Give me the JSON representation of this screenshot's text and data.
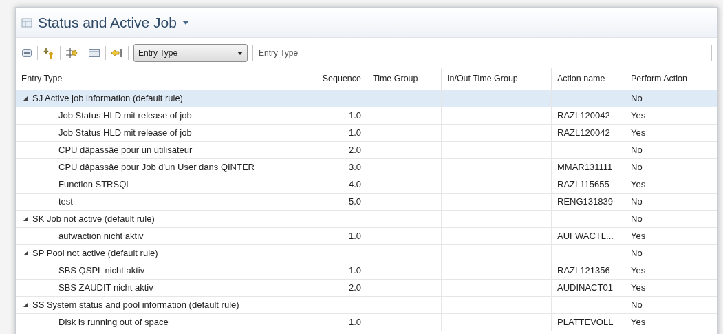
{
  "view": {
    "title": "Status and Active Job"
  },
  "toolbar": {
    "filter_column": "Entry Type",
    "filter_field": {
      "placeholder": "Entry Type"
    }
  },
  "table": {
    "columns": [
      "Entry Type",
      "Sequence",
      "Time Group",
      "In/Out Time Group",
      "Action name",
      "Perform Action"
    ],
    "groups": [
      {
        "label": "SJ Active job information (default rule)",
        "expanded": true,
        "selected": true,
        "perform": "No",
        "children": [
          {
            "entry": "Job Status HLD mit release of job",
            "sequence": "1.0",
            "action": "RAZL120042",
            "perform": "Yes"
          },
          {
            "entry": "Job Status HLD mit release of job",
            "sequence": "1.0",
            "action": "RAZL120042",
            "perform": "Yes"
          },
          {
            "entry": "CPU dâpassâe  pour un utilisateur",
            "sequence": "2.0",
            "perform": "No"
          },
          {
            "entry": "CPU dâpassâe pour Job d'un User dans QINTER",
            "sequence": "3.0",
            "action": "MMAR131111",
            "perform": "No"
          },
          {
            "entry": "Function STRSQL",
            "sequence": "4.0",
            "action": "RAZL115655",
            "perform": "Yes"
          },
          {
            "entry": "test",
            "sequence": "5.0",
            "action": "RENG131839",
            "perform": "No"
          }
        ]
      },
      {
        "label": "SK Job not active (default rule)",
        "expanded": true,
        "selected": false,
        "perform": "No",
        "children": [
          {
            "entry": "aufwaction nicht aktiv",
            "sequence": "1.0",
            "action": "AUFWACTL...",
            "perform": "Yes"
          }
        ]
      },
      {
        "label": "SP Pool not active (default rule)",
        "expanded": true,
        "selected": false,
        "perform": "No",
        "children": [
          {
            "entry": "SBS QSPL nicht aktiv",
            "sequence": "1.0",
            "action": "RAZL121356",
            "perform": "Yes"
          },
          {
            "entry": "SBS ZAUDIT nicht aktiv",
            "sequence": "2.0",
            "action": "AUDINACT01",
            "perform": "Yes"
          }
        ]
      },
      {
        "label": "SS System status and pool information (default rule)",
        "expanded": true,
        "selected": false,
        "perform": "No",
        "children": [
          {
            "entry": "Disk is running out of space",
            "sequence": "1.0",
            "action": "PLATTEVOLL",
            "perform": "Yes"
          }
        ]
      }
    ]
  }
}
